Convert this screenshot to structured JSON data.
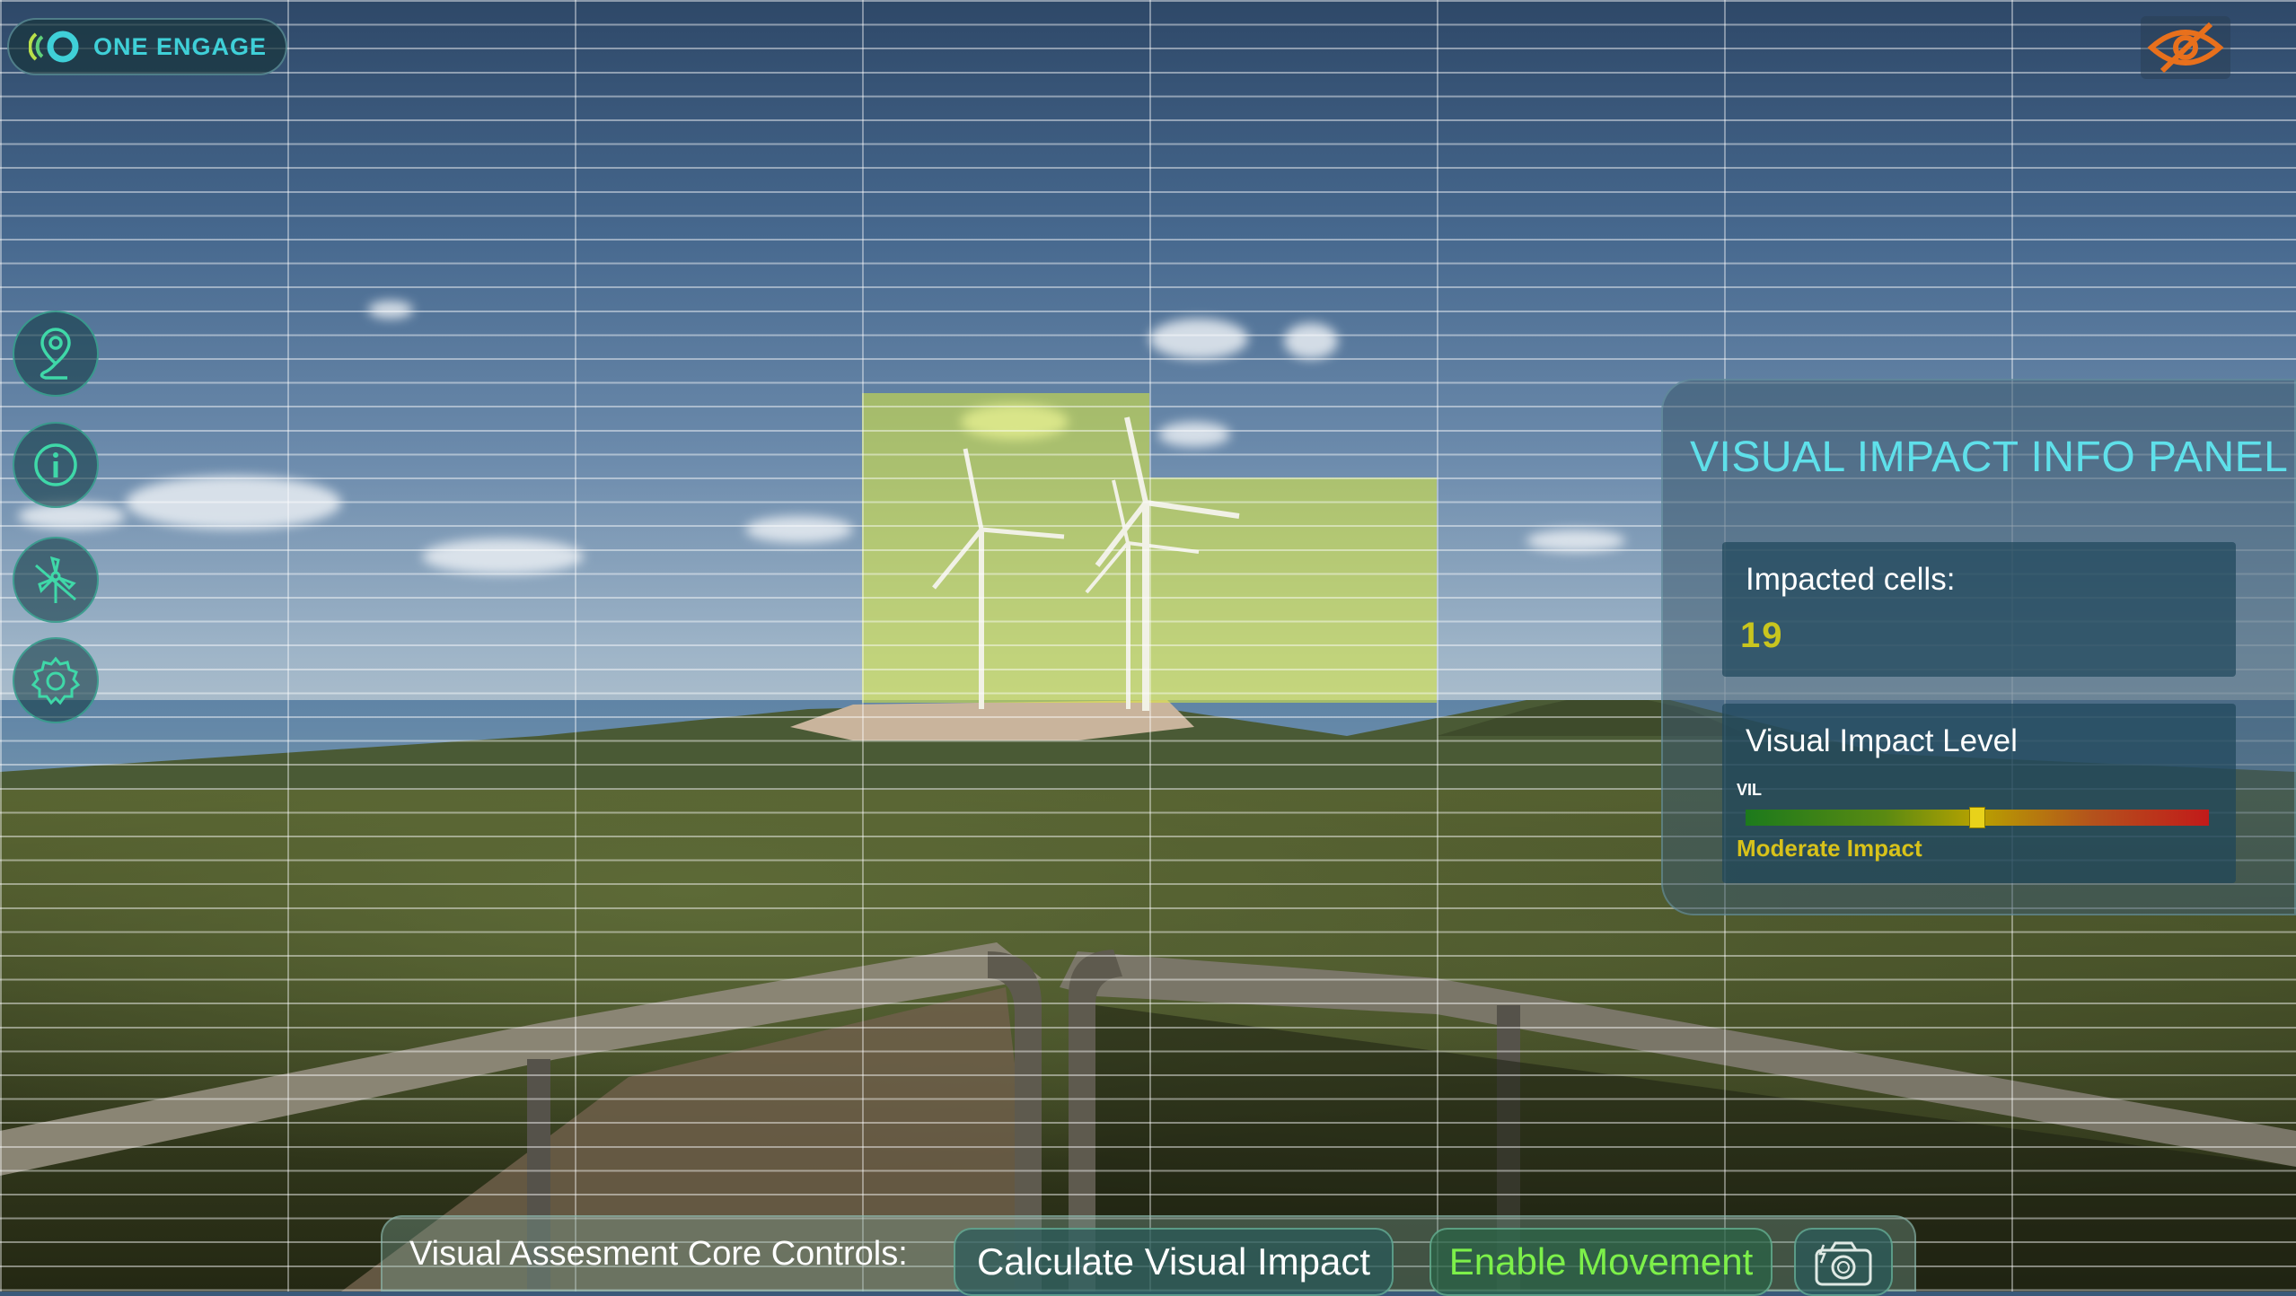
{
  "logo": {
    "text": "ONE ENGAGE",
    "icon": "one-engage-logo-icon"
  },
  "top_right": {
    "icon": "eye-slash-icon",
    "color": "#e8701c"
  },
  "sidebar": {
    "items": [
      {
        "icon": "location-pin-icon"
      },
      {
        "icon": "info-icon"
      },
      {
        "icon": "wind-turbine-icon"
      },
      {
        "icon": "gear-icon"
      }
    ],
    "accent": "#3fd8a8"
  },
  "info_panel": {
    "title": "VISUAL IMPACT INFO PANEL",
    "impacted_cells_label": "Impacted cells:",
    "impacted_cells_value": "19",
    "vil_title": "Visual Impact Level",
    "vil_short": "VIL",
    "vil_level": 0.5,
    "vil_text": "Moderate Impact"
  },
  "controls": {
    "label": "Visual Assesment Core Controls:",
    "calculate_label": "Calculate Visual Impact",
    "movement_label": "Enable Movement",
    "camera_icon": "camera-icon"
  },
  "colors": {
    "accent_cyan": "#5fe0ea",
    "impact_yellow": "#d8c21a",
    "movement_green": "#7df04a",
    "impact_highlight": "#dceb3c"
  }
}
